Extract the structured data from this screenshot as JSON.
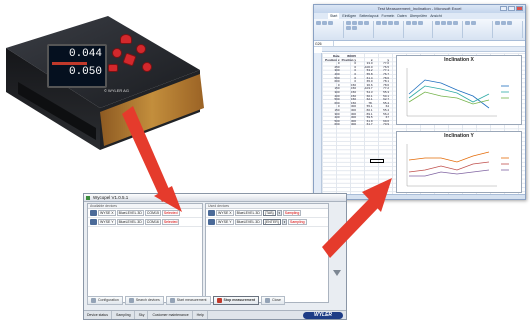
{
  "device": {
    "readout_top": "0.044",
    "readout_bottom": "0.050",
    "brand_label": "© WYLER AG"
  },
  "excel": {
    "title": "Test Measurement_Inclination - Microsoft Excel",
    "tabs": [
      "Start",
      "Einfügen",
      "Seitenlayout",
      "Formeln",
      "Daten",
      "Überprüfen",
      "Ansicht"
    ],
    "name_box": "G26",
    "table": {
      "header_line1": [
        "Date",
        "WXO5"
      ],
      "header_line2": [
        "Position x",
        "Position y",
        "x",
        "y"
      ],
      "rows": [
        [
          "0",
          "0",
          "33.0",
          "77.0"
        ],
        [
          "250",
          "0",
          "-100.0",
          "76.5"
        ],
        [
          "300",
          "0",
          "53.2",
          "77.1"
        ],
        [
          "400",
          "0",
          "55.8",
          "76.7"
        ],
        [
          "500",
          "0",
          "61.4",
          "78.6"
        ],
        [
          "600",
          "0",
          "65.0",
          "78.1"
        ],
        [
          "0",
          "150",
          "36.6",
          "78.6"
        ],
        [
          "150",
          "150",
          "-103.7",
          "77.2"
        ],
        [
          "300",
          "150",
          "54.3",
          "55.3"
        ],
        [
          "400",
          "150",
          "60.1",
          "50.1"
        ],
        [
          "500",
          "150",
          "62.1",
          "62.7"
        ],
        [
          "600",
          "150",
          "78.",
          "55.4"
        ],
        [
          "0",
          "300",
          "55.1",
          "64"
        ],
        [
          "150",
          "300",
          "-56.1",
          "55.4"
        ],
        [
          "300",
          "300",
          "-59.1",
          "56.2"
        ],
        [
          "400",
          "300",
          "59.5",
          "67"
        ],
        [
          "500",
          "300",
          "61.9",
          "69.6"
        ],
        [
          "600",
          "300",
          "61.7",
          "70.9"
        ]
      ]
    },
    "chart_x": {
      "title": "Inclination X"
    },
    "chart_y": {
      "title": "Inclination Y"
    }
  },
  "app": {
    "title": "Wycopel V1.0.5.1",
    "connected_caption": "Available devices",
    "right_caption": "Used devices",
    "left_devices": [
      {
        "name": "WYSE X",
        "model": "BlueLEVEL 3D",
        "port": "COM15",
        "state": "Selected"
      },
      {
        "name": "WYSE Y",
        "model": "BlueLEVEL 3D",
        "port": "COM16",
        "state": "Selected"
      }
    ],
    "right_devices": [
      {
        "name": "WYSE X",
        "model": "BlueLEVEL 3D",
        "key": "{TAB}",
        "state": "Sampling"
      },
      {
        "name": "WYSE Y",
        "model": "BlueLEVEL 3D",
        "key": "{ENTER}",
        "state": "Sampling"
      }
    ],
    "toolbar": {
      "configuration": "Configuration",
      "search": "Search devices",
      "start": "Start measurement",
      "stop": "Stop measurement",
      "close": "Close"
    },
    "status": {
      "device_label": "Device status",
      "device_value": "Sampling",
      "sky_label": "Sky",
      "maintenance": "Customer maintenance",
      "help": "Help",
      "logo": "WYLER"
    }
  },
  "colors": {
    "arrow": "#e53b2c",
    "excel_border": "#8aa1c3",
    "app_bg": "#e9edf2"
  }
}
